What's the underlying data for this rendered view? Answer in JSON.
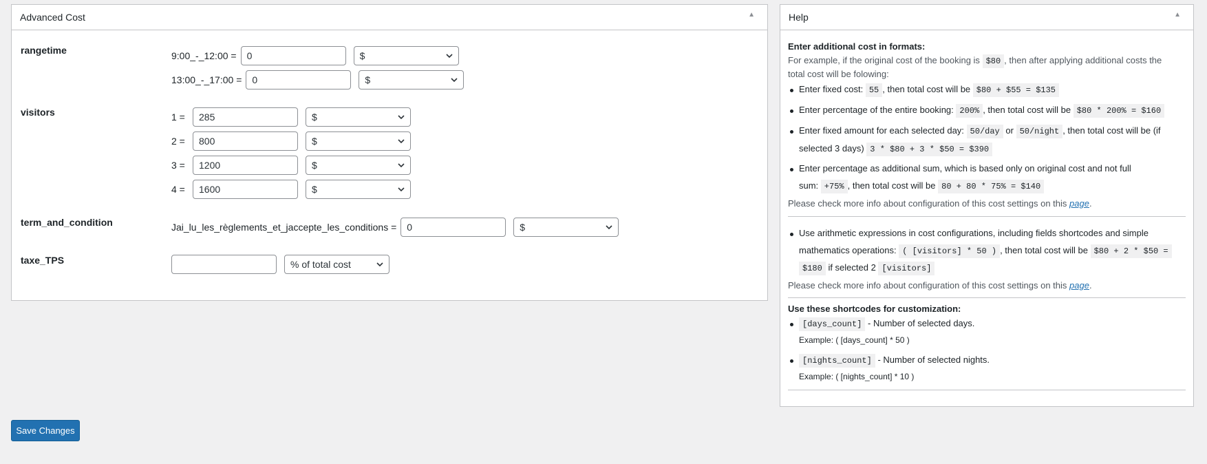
{
  "cost_panel": {
    "title": "Advanced Cost",
    "toggle_icon": "▲",
    "rows": [
      {
        "label": "rangetime",
        "fields": [
          {
            "label": "9:00_-_12:00 =",
            "value": "0",
            "currency": "$"
          },
          {
            "label": "13:00_-_17:00 =",
            "value": "0",
            "currency": "$"
          }
        ]
      },
      {
        "label": "visitors",
        "fields": [
          {
            "label": "1 =",
            "value": "285",
            "currency": "$"
          },
          {
            "label": "2 =",
            "value": "800",
            "currency": "$"
          },
          {
            "label": "3 =",
            "value": "1200",
            "currency": "$"
          },
          {
            "label": "4 =",
            "value": "1600",
            "currency": "$"
          }
        ]
      },
      {
        "label": "term_and_condition",
        "fields": [
          {
            "label": "Jai_lu_les_règlements_et_jaccepte_les_conditions =",
            "value": "0",
            "currency": "$"
          }
        ]
      },
      {
        "label": "taxe_TPS",
        "fields": [
          {
            "label": "",
            "value": "",
            "currency": "% of total cost"
          }
        ]
      }
    ]
  },
  "help_panel": {
    "title": "Help",
    "toggle_icon": "▲",
    "intro_heading": "Enter additional cost in formats:",
    "intro_line1_a": "For example, if the original cost of the booking is",
    "intro_line1_code": "$80",
    "intro_line1_b": ", then after applying additional costs the",
    "intro_line2": "total cost will be folowing:",
    "b1_a": "Enter fixed cost:",
    "b1_code1": "55",
    "b1_b": ", then total cost will be",
    "b1_code2": "$80 + $55 = $135",
    "b2_a": "Enter percentage of the entire booking:",
    "b2_code1": "200%",
    "b2_b": ", then total cost will be",
    "b2_code2": "$80 * 200% = $160",
    "b3_a": "Enter fixed amount for each selected day:",
    "b3_code1": "50/day",
    "b3_or": "or",
    "b3_code2": "50/night",
    "b3_b": ", then total cost will be (if",
    "b3_c": "selected 3 days)",
    "b3_code3": "3 * $80 + 3 * $50 = $390",
    "b4_a": "Enter percentage as additional sum, which is based only on original cost and not full",
    "b4_b": "sum:",
    "b4_code1": "+75%",
    "b4_c": ", then total cost will be",
    "b4_code2": "80 + 80 * 75% = $140",
    "more_info_a": "Please check more info about configuration of this cost settings on this",
    "more_info_link": "page",
    "more_info_dot": ".",
    "b5_a": "Use arithmetic expressions in cost configurations, including fields shortcodes and simple",
    "b5_b": "mathematics operations:",
    "b5_code1": "( [visitors] * 50 )",
    "b5_c": ", then total cost will be",
    "b5_code2": "$80 + 2 * $50 =",
    "b5_code3": "$180",
    "b5_d": "if selected 2",
    "b5_code4": "[visitors]",
    "more_info2_a": "Please check more info about configuration of this cost settings on this",
    "more_info2_link": "page",
    "more_info2_dot": ".",
    "shortcodes_heading": "Use these shortcodes for customization:",
    "s1_code": "[days_count]",
    "s1_desc": "- Number of selected days.",
    "s1_example": "Example: ( [days_count] * 50 )",
    "s2_code": "[nights_count]",
    "s2_desc": "- Number of selected nights.",
    "s2_example": "Example: ( [nights_count] * 10 )"
  },
  "save_button": "Save Changes"
}
